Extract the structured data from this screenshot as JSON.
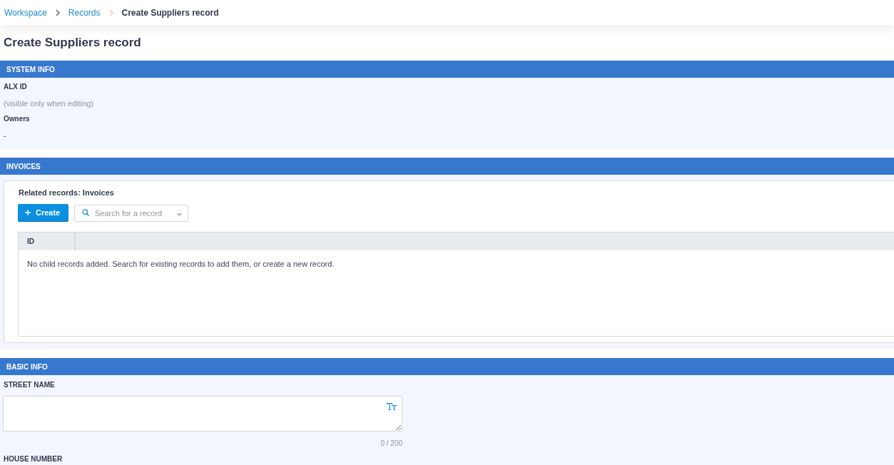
{
  "breadcrumb": [
    {
      "label": "Workspace",
      "kind": "link"
    },
    {
      "label": "Records",
      "kind": "link"
    },
    {
      "label": "Create Suppliers record",
      "kind": "current"
    }
  ],
  "page_title": "Create Suppliers record",
  "sections": [
    {
      "kind": "fields",
      "title": "SYSTEM INFO",
      "fields": [
        {
          "label": "ALX ID",
          "value": "(visible only when editing)",
          "kind": "hint"
        },
        {
          "label": "Owners",
          "value": "-",
          "kind": "text"
        }
      ]
    },
    {
      "kind": "related",
      "title": "INVOICES",
      "heading": "Related records: Invoices",
      "create_button": {
        "label": "Create"
      },
      "search": {
        "placeholder": "Search for a record"
      },
      "table": {
        "columns": [
          "ID"
        ],
        "empty_message": "No child records added. Search for existing records to add them, or create a new record."
      }
    },
    {
      "kind": "form",
      "title": "BASIC INFO",
      "fields": [
        {
          "label": "STREET NAME",
          "kind": "textarea",
          "counter": "0 / 200"
        },
        {
          "label": "HOUSE NUMBER",
          "kind": "text"
        }
      ]
    }
  ]
}
